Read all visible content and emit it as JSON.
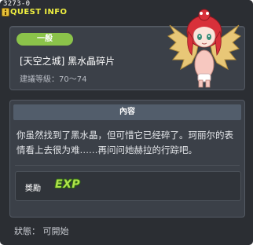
{
  "quest": {
    "id": "3273-0",
    "window_title": "QUEST INFO",
    "category": "一般",
    "name": "[天空之城] 黑水晶碎片",
    "recommended_level": "建議等級：70～74"
  },
  "content": {
    "header": "內容",
    "text": "你虽然找到了黑水晶，但可惜它已经碎了。珂丽尔的表情看上去很为难……再问问她赫拉的行踪吧。"
  },
  "reward": {
    "label": "獎勵",
    "exp_icon_text": "EXP"
  },
  "status": {
    "text": "狀態： 可開始"
  },
  "colors": {
    "title": "#f0f040",
    "badge": "#8bc34a",
    "background": "#2b2e33",
    "panel": "#3b4048"
  }
}
